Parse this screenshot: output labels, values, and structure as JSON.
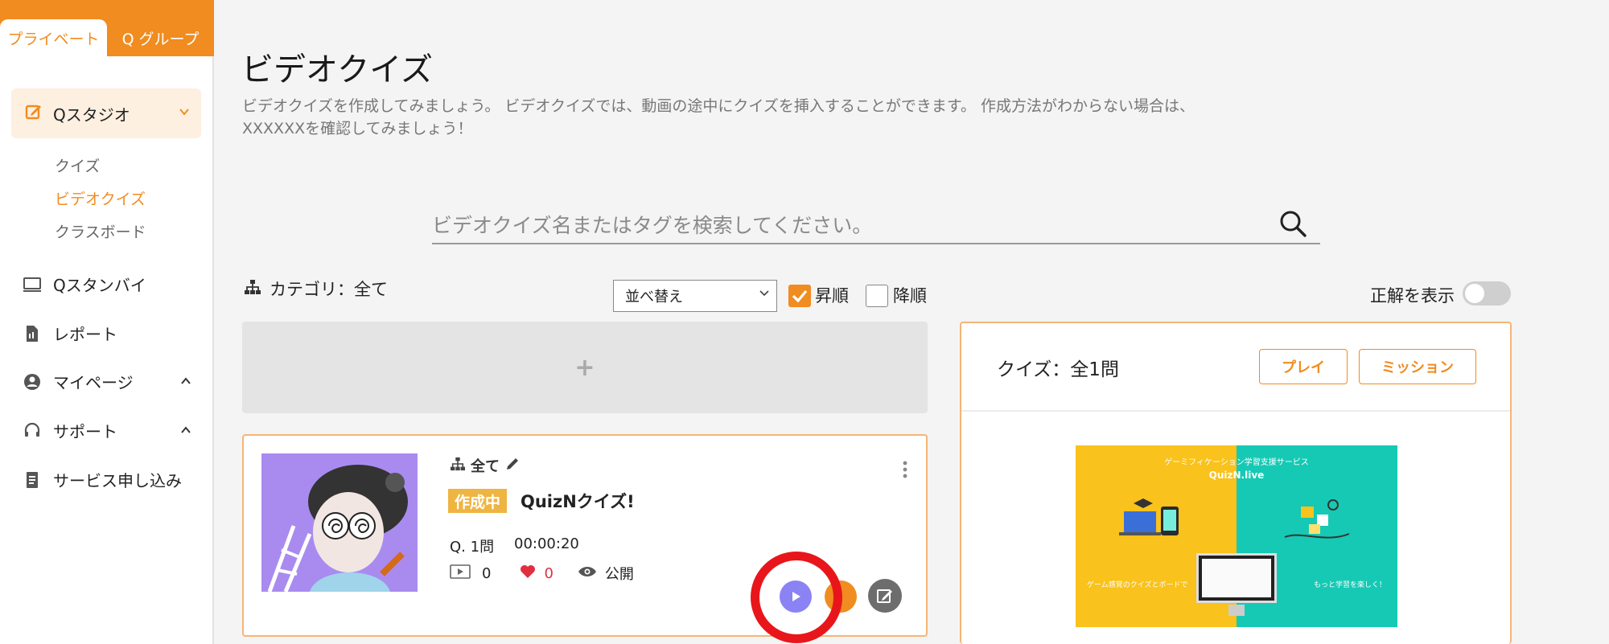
{
  "sidebar": {
    "tabs": {
      "private": "プライベート",
      "group": "Q グループ"
    },
    "studio": {
      "label": "Qスタジオ"
    },
    "sub_items": [
      "クイズ",
      "ビデオクイズ",
      "クラスボード"
    ],
    "items": {
      "standby": "Qスタンバイ",
      "report": "レポート",
      "mypage": "マイページ",
      "support": "サポート",
      "service": "サービス申し込み"
    }
  },
  "page": {
    "title": "ビデオクイズ",
    "description": "ビデオクイズを作成してみましょう。 ビデオクイズでは、動画の途中にクイズを挿入することができます。 作成方法がわからない場合は、XXXXXXを確認してみましょう！"
  },
  "search": {
    "placeholder": "ビデオクイズ名またはタグを検索してください。"
  },
  "filters": {
    "category": "カテゴリ：全て",
    "sort_label": "並べ替え",
    "asc": "昇順",
    "desc": "降順",
    "show_answer": "正解を表示"
  },
  "add": {
    "label": "+"
  },
  "quiz_card": {
    "category": "全て",
    "status": "作成中",
    "title": "QuizNクイズ!",
    "questions": "Q. 1問",
    "duration": "00:00:20",
    "plays": "0",
    "likes": "0",
    "visibility": "公開"
  },
  "panel": {
    "count": "クイズ：全1問",
    "play": "プレイ",
    "mission": "ミッション",
    "preview": {
      "header": "ゲーミフィケーション学習支援サービス",
      "brand": "QuizN.live",
      "caption_left": "ゲーム感覚のクイズとボードで",
      "caption_right": "もっと学習を楽しく！"
    }
  },
  "colors": {
    "accent": "#f08c20",
    "highlight": "#e8161b",
    "play": "#8b82f5"
  }
}
